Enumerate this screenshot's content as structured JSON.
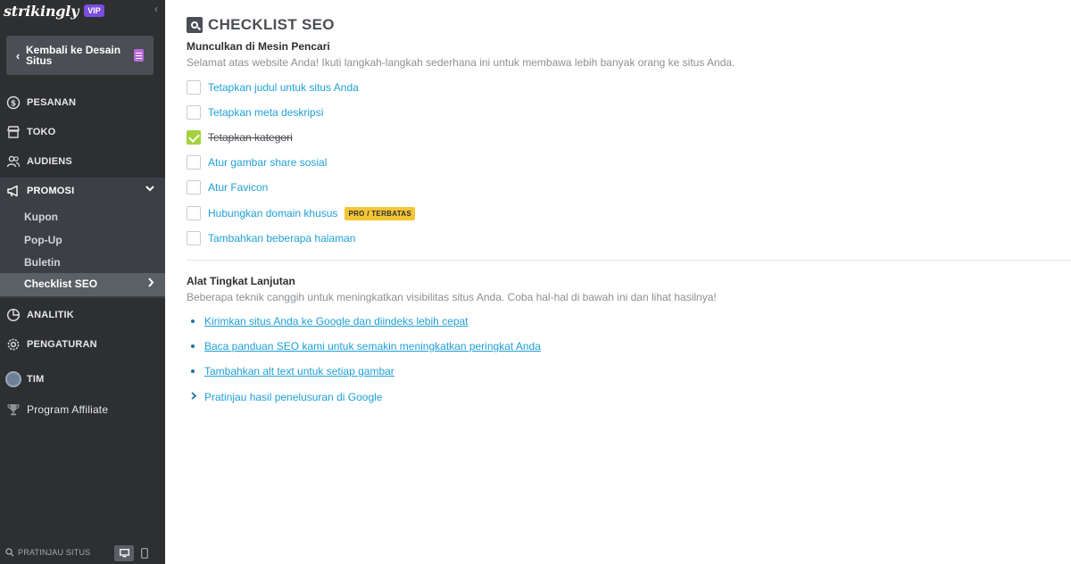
{
  "sidebar": {
    "brand": "strikingly",
    "vip_badge": "VIP",
    "collapse_glyph": "‹",
    "back_button": "Kembali ke Desain Situs",
    "nav": {
      "pesanan": "PESANAN",
      "toko": "TOKO",
      "audiens": "AUDIENS",
      "promosi": "PROMOSI",
      "analitik": "ANALITIK",
      "pengaturan": "PENGATURAN",
      "tim": "TIM",
      "affiliate": "Program Affiliate"
    },
    "promosi_sub": {
      "kupon": "Kupon",
      "popup": "Pop-Up",
      "buletin": "Buletin",
      "checklist": "Checklist SEO"
    },
    "footer": {
      "preview": "PRATINJAU SITUS"
    }
  },
  "main": {
    "title": "CHECKLIST SEO",
    "section1": {
      "heading": "Munculkan di Mesin Pencari",
      "desc": "Selamat atas website Anda! Ikuti langkah-langkah sederhana ini untuk membawa lebih banyak orang ke situs Anda.",
      "items": [
        {
          "label": "Tetapkan judul untuk situs Anda",
          "checked": false
        },
        {
          "label": "Tetapkan meta deskripsi",
          "checked": false
        },
        {
          "label": "Tetapkan kategori",
          "checked": true
        },
        {
          "label": "Atur gambar share sosial",
          "checked": false
        },
        {
          "label": "Atur Favicon",
          "checked": false
        },
        {
          "label": "Hubungkan domain khusus",
          "checked": false,
          "badge": "PRO / TERBATAS"
        },
        {
          "label": "Tambahkan beberapa halaman",
          "checked": false
        }
      ]
    },
    "section2": {
      "heading": "Alat Tingkat Lanjutan",
      "desc": "Beberapa teknik canggih untuk meningkatkan visibilitas situs Anda. Coba hal-hal di bawah ini dan lihat hasilnya!",
      "links": [
        "Kirimkan situs Anda ke Google dan diindeks lebih cepat",
        "Baca panduan SEO kami untuk semakin meningkatkan peringkat Anda",
        "Tambahkan alt text untuk setiap gambar"
      ],
      "expand_link": "Pratinjau hasil penelusuran di Google"
    }
  },
  "colors": {
    "sidebar_bg": "#2e2f31",
    "sidebar_active": "#3c3f44",
    "link": "#1f9fd7",
    "check": "#a4d23f",
    "badge": "#f4c535",
    "vip": "#7b4de0"
  }
}
